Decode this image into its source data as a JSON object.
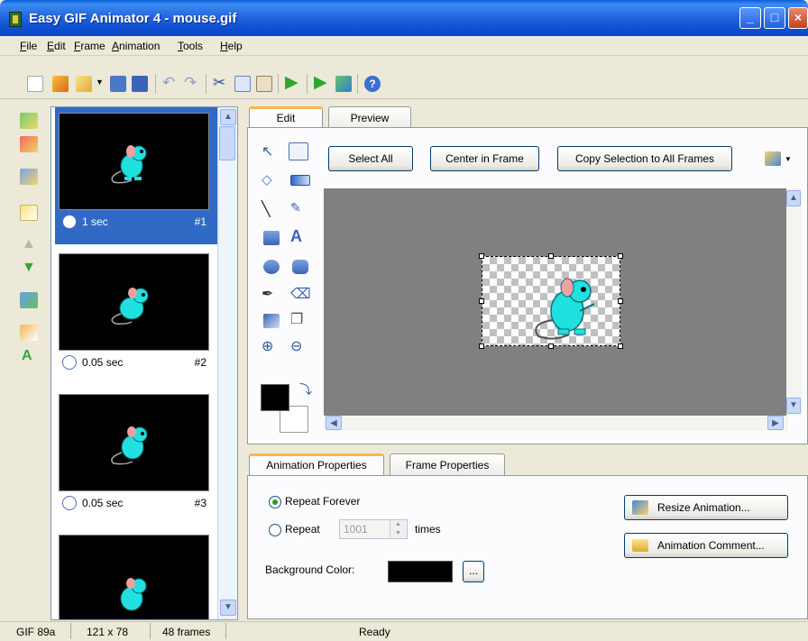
{
  "window": {
    "title": "Easy GIF Animator 4 - mouse.gif"
  },
  "menu": [
    "File",
    "Edit",
    "Frame",
    "Animation",
    "Tools",
    "Help"
  ],
  "menu_mnemonics": [
    "F",
    "E",
    "F",
    "A",
    "T",
    "H"
  ],
  "frames": [
    {
      "duration": "1 sec",
      "number": "#1",
      "selected": true
    },
    {
      "duration": "0.05 sec",
      "number": "#2",
      "selected": false
    },
    {
      "duration": "0.05 sec",
      "number": "#3",
      "selected": false
    }
  ],
  "editor": {
    "tabs": [
      "Edit",
      "Preview"
    ],
    "buttons": {
      "select_all": "Select All",
      "center": "Center in Frame",
      "copy_selection": "Copy Selection to All Frames"
    }
  },
  "properties": {
    "tabs": [
      "Animation Properties",
      "Frame Properties"
    ],
    "repeat_forever": "Repeat Forever",
    "repeat": "Repeat",
    "repeat_count": "1001",
    "times": "times",
    "background_color_label": "Background Color:",
    "background_color": "#000000",
    "browse": "...",
    "resize_button": "Resize Animation...",
    "comment_button": "Animation Comment..."
  },
  "status": {
    "format": "GIF 89a",
    "size": "121 x 78",
    "frames": "48 frames",
    "state": "Ready"
  },
  "colors": {
    "accent": "#316ac5",
    "mouse": "#20e0e0",
    "canvas": "#808080"
  },
  "icons": [
    "new-icon",
    "open-wizard-icon",
    "open-icon",
    "save-icon",
    "save-as-icon",
    "undo-icon",
    "redo-icon",
    "cut-icon",
    "copy-icon",
    "paste-icon",
    "play-icon",
    "preview-browser-icon",
    "optimize-icon",
    "help-icon"
  ]
}
